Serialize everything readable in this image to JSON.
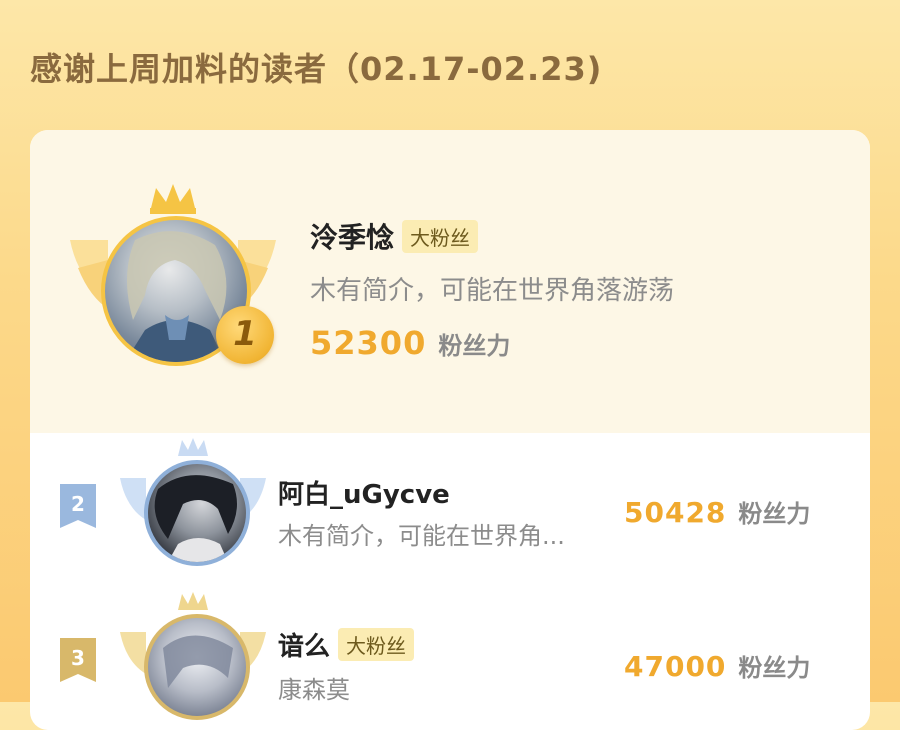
{
  "page": {
    "title": "感谢上周加料的读者（02.17-02.23)"
  },
  "colors": {
    "score": "#f0a92e",
    "badge_bg": "#fbecb3",
    "gold": "#f5c444",
    "silver_blue": "#8fb0d9",
    "bronze": "#d8b86a"
  },
  "readers": [
    {
      "rank": "1",
      "name": "泠季惗",
      "badge": "大粉丝",
      "bio": "木有简介，可能在世界角落游荡",
      "score": "52300",
      "score_label": "粉丝力"
    },
    {
      "rank": "2",
      "name": "阿白_uGycve",
      "badge": "",
      "bio": "木有简介，可能在世界角...",
      "score": "50428",
      "score_label": "粉丝力"
    },
    {
      "rank": "3",
      "name": "谙么",
      "badge": "大粉丝",
      "bio": "康森莫",
      "score": "47000",
      "score_label": "粉丝力"
    }
  ]
}
